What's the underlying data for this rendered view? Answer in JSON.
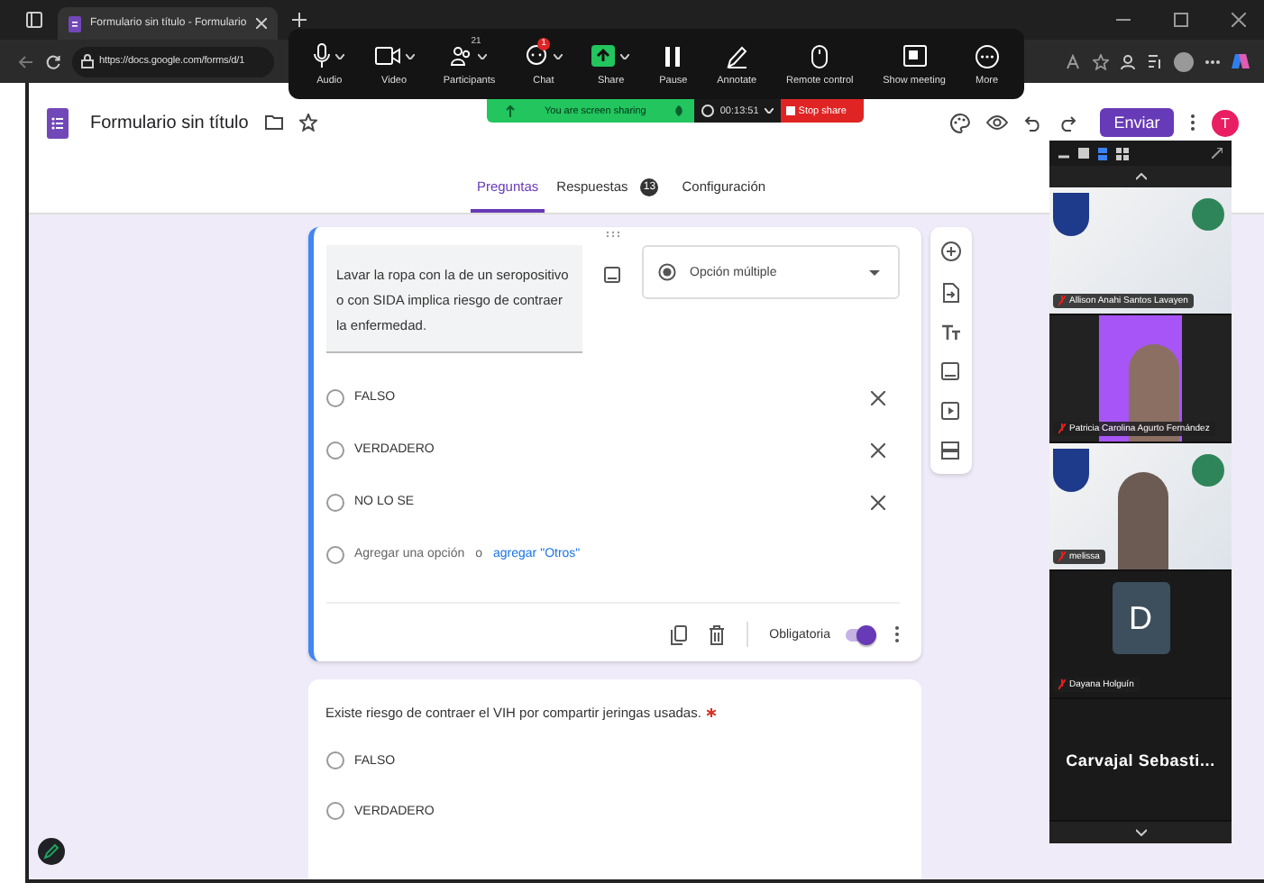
{
  "browser": {
    "tab_title": "Formulario sin título - Formulario",
    "url": "https://docs.google.com/forms/d/1"
  },
  "zoom_toolbar": [
    {
      "kind": "mic",
      "label": "Audio"
    },
    {
      "kind": "video",
      "label": "Video"
    },
    {
      "kind": "people",
      "label": "Participants",
      "count": "21"
    },
    {
      "kind": "chat",
      "label": "Chat",
      "badge": "1"
    },
    {
      "kind": "share",
      "label": "Share"
    },
    {
      "kind": "pause",
      "label": "Pause"
    },
    {
      "kind": "pen",
      "label": "Annotate"
    },
    {
      "kind": "mouse",
      "label": "Remote control"
    },
    {
      "kind": "meeting",
      "label": "Show meeting"
    },
    {
      "kind": "more",
      "label": "More"
    }
  ],
  "share_banner": {
    "message": "You are screen sharing",
    "timer": "00:13:51",
    "stop": "Stop share"
  },
  "form": {
    "title": "Formulario sin título",
    "send_button": "Enviar",
    "avatar_initial": "T",
    "tabs": [
      {
        "label": "Preguntas",
        "selected": true
      },
      {
        "label": "Respuestas",
        "badge": "13",
        "selected": false
      },
      {
        "label": "Configuración",
        "selected": false
      }
    ]
  },
  "questions": [
    {
      "kind": "editing",
      "text": "Lavar la ropa con la de un seropositivo o con SIDA implica riesgo de contraer la enfermedad.",
      "type": "Opción múltiple",
      "options": [
        {
          "label": "FALSO",
          "selected": false
        },
        {
          "label": "VERDADERO",
          "selected": false
        },
        {
          "label": "NO LO SE",
          "selected": false
        }
      ],
      "add_option": "Agregar una opción",
      "add_or": "o",
      "add_other": "agregar \"Otros\"",
      "required_label": "Obligatoria",
      "required": true
    },
    {
      "kind": "preview",
      "text": "Existe riesgo de contraer el VIH por compartir jeringas usadas.",
      "required": true,
      "options": [
        {
          "label": "FALSO",
          "selected": false
        },
        {
          "label": "VERDADERO",
          "selected": false
        }
      ]
    }
  ],
  "gallery": {
    "tiles": [
      {
        "kind": "background",
        "name": "Allison Anahi Santos Lavayen"
      },
      {
        "kind": "photo",
        "name": "Patricia Carolina Agurto Fernández"
      },
      {
        "kind": "background",
        "name": "melissa"
      },
      {
        "kind": "avatar",
        "initial": "D",
        "name": "Dayana Holguín"
      },
      {
        "kind": "name_only",
        "name": "Carvajal Sebasti..."
      }
    ]
  }
}
